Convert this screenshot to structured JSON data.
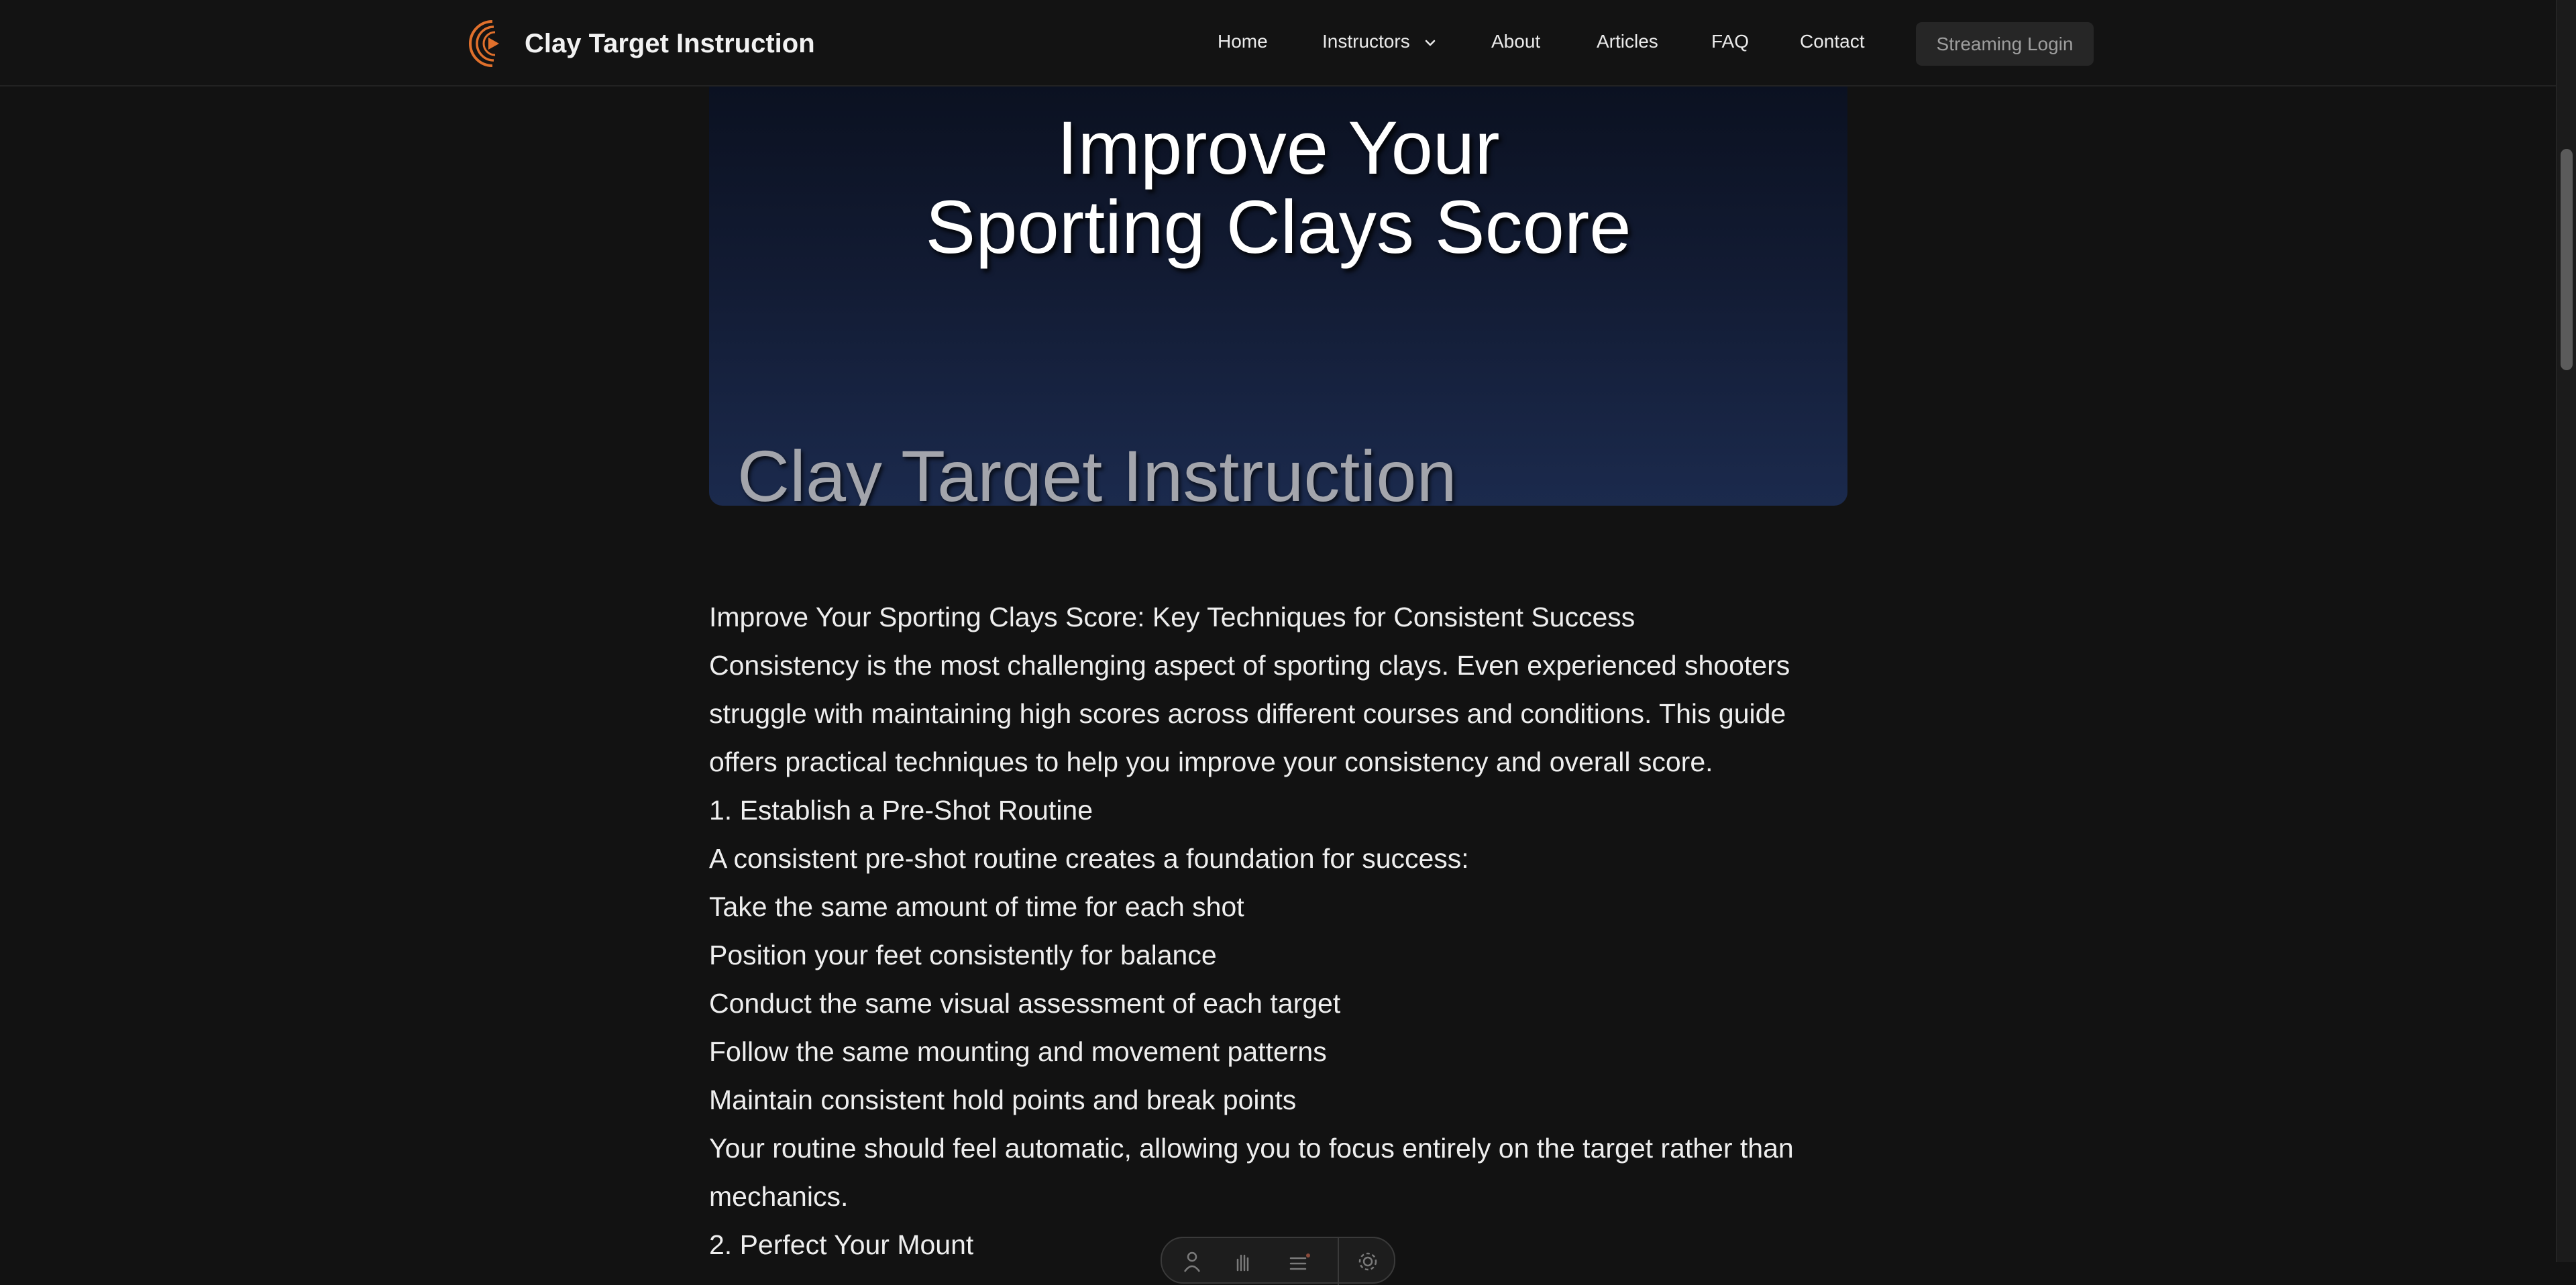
{
  "header": {
    "site_name": "Clay Target Instruction",
    "nav": {
      "home": "Home",
      "instructors": "Instructors",
      "about": "About",
      "articles": "Articles",
      "faq": "FAQ",
      "contact": "Contact"
    },
    "login_label": "Streaming Login",
    "brand_color": "#e0702c"
  },
  "hero": {
    "title_line1": "Improve Your",
    "title_line2": "Sporting Clays Score",
    "footer_text": "Clay Target Instruction"
  },
  "article": {
    "paragraphs": [
      "Improve Your Sporting Clays Score: Key Techniques for Consistent Success",
      "Consistency is the most challenging aspect of sporting clays. Even experienced shooters struggle with maintaining high scores across different courses and conditions. This guide offers practical techniques to help you improve your consistency and overall score.",
      "1. Establish a Pre-Shot Routine",
      "A consistent pre-shot routine creates a foundation for success:",
      "Take the same amount of time for each shot",
      "Position your feet consistently for balance",
      "Conduct the same visual assessment of each target",
      "Follow the same mounting and movement patterns",
      "Maintain consistent hold points and break points",
      "Your routine should feel automatic, allowing you to focus entirely on the target rather than mechanics.",
      "2. Perfect Your Mount"
    ]
  },
  "toolbar": {
    "icons": [
      "person-icon",
      "hand-icon",
      "list-icon",
      "gear-icon"
    ]
  }
}
